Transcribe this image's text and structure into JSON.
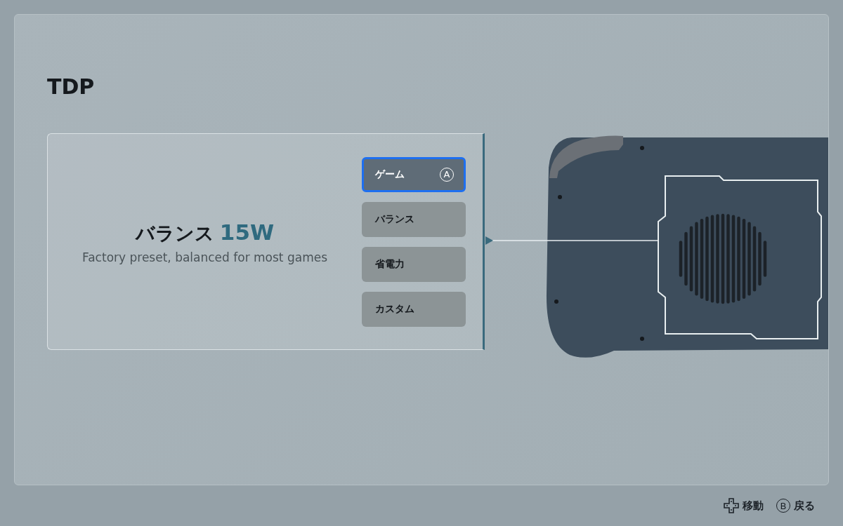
{
  "title": "TDP",
  "detail": {
    "name": "バランス",
    "value": "15W",
    "description": "Factory preset, balanced for most games"
  },
  "confirm_glyph": "A",
  "presets": [
    {
      "label": "ゲーム",
      "selected": true
    },
    {
      "label": "バランス",
      "selected": false
    },
    {
      "label": "省電力",
      "selected": false
    },
    {
      "label": "カスタム",
      "selected": false
    }
  ],
  "footer_hints": [
    {
      "kind": "dpad",
      "label": "移動"
    },
    {
      "kind": "button",
      "glyph": "B",
      "label": "戻る"
    }
  ]
}
